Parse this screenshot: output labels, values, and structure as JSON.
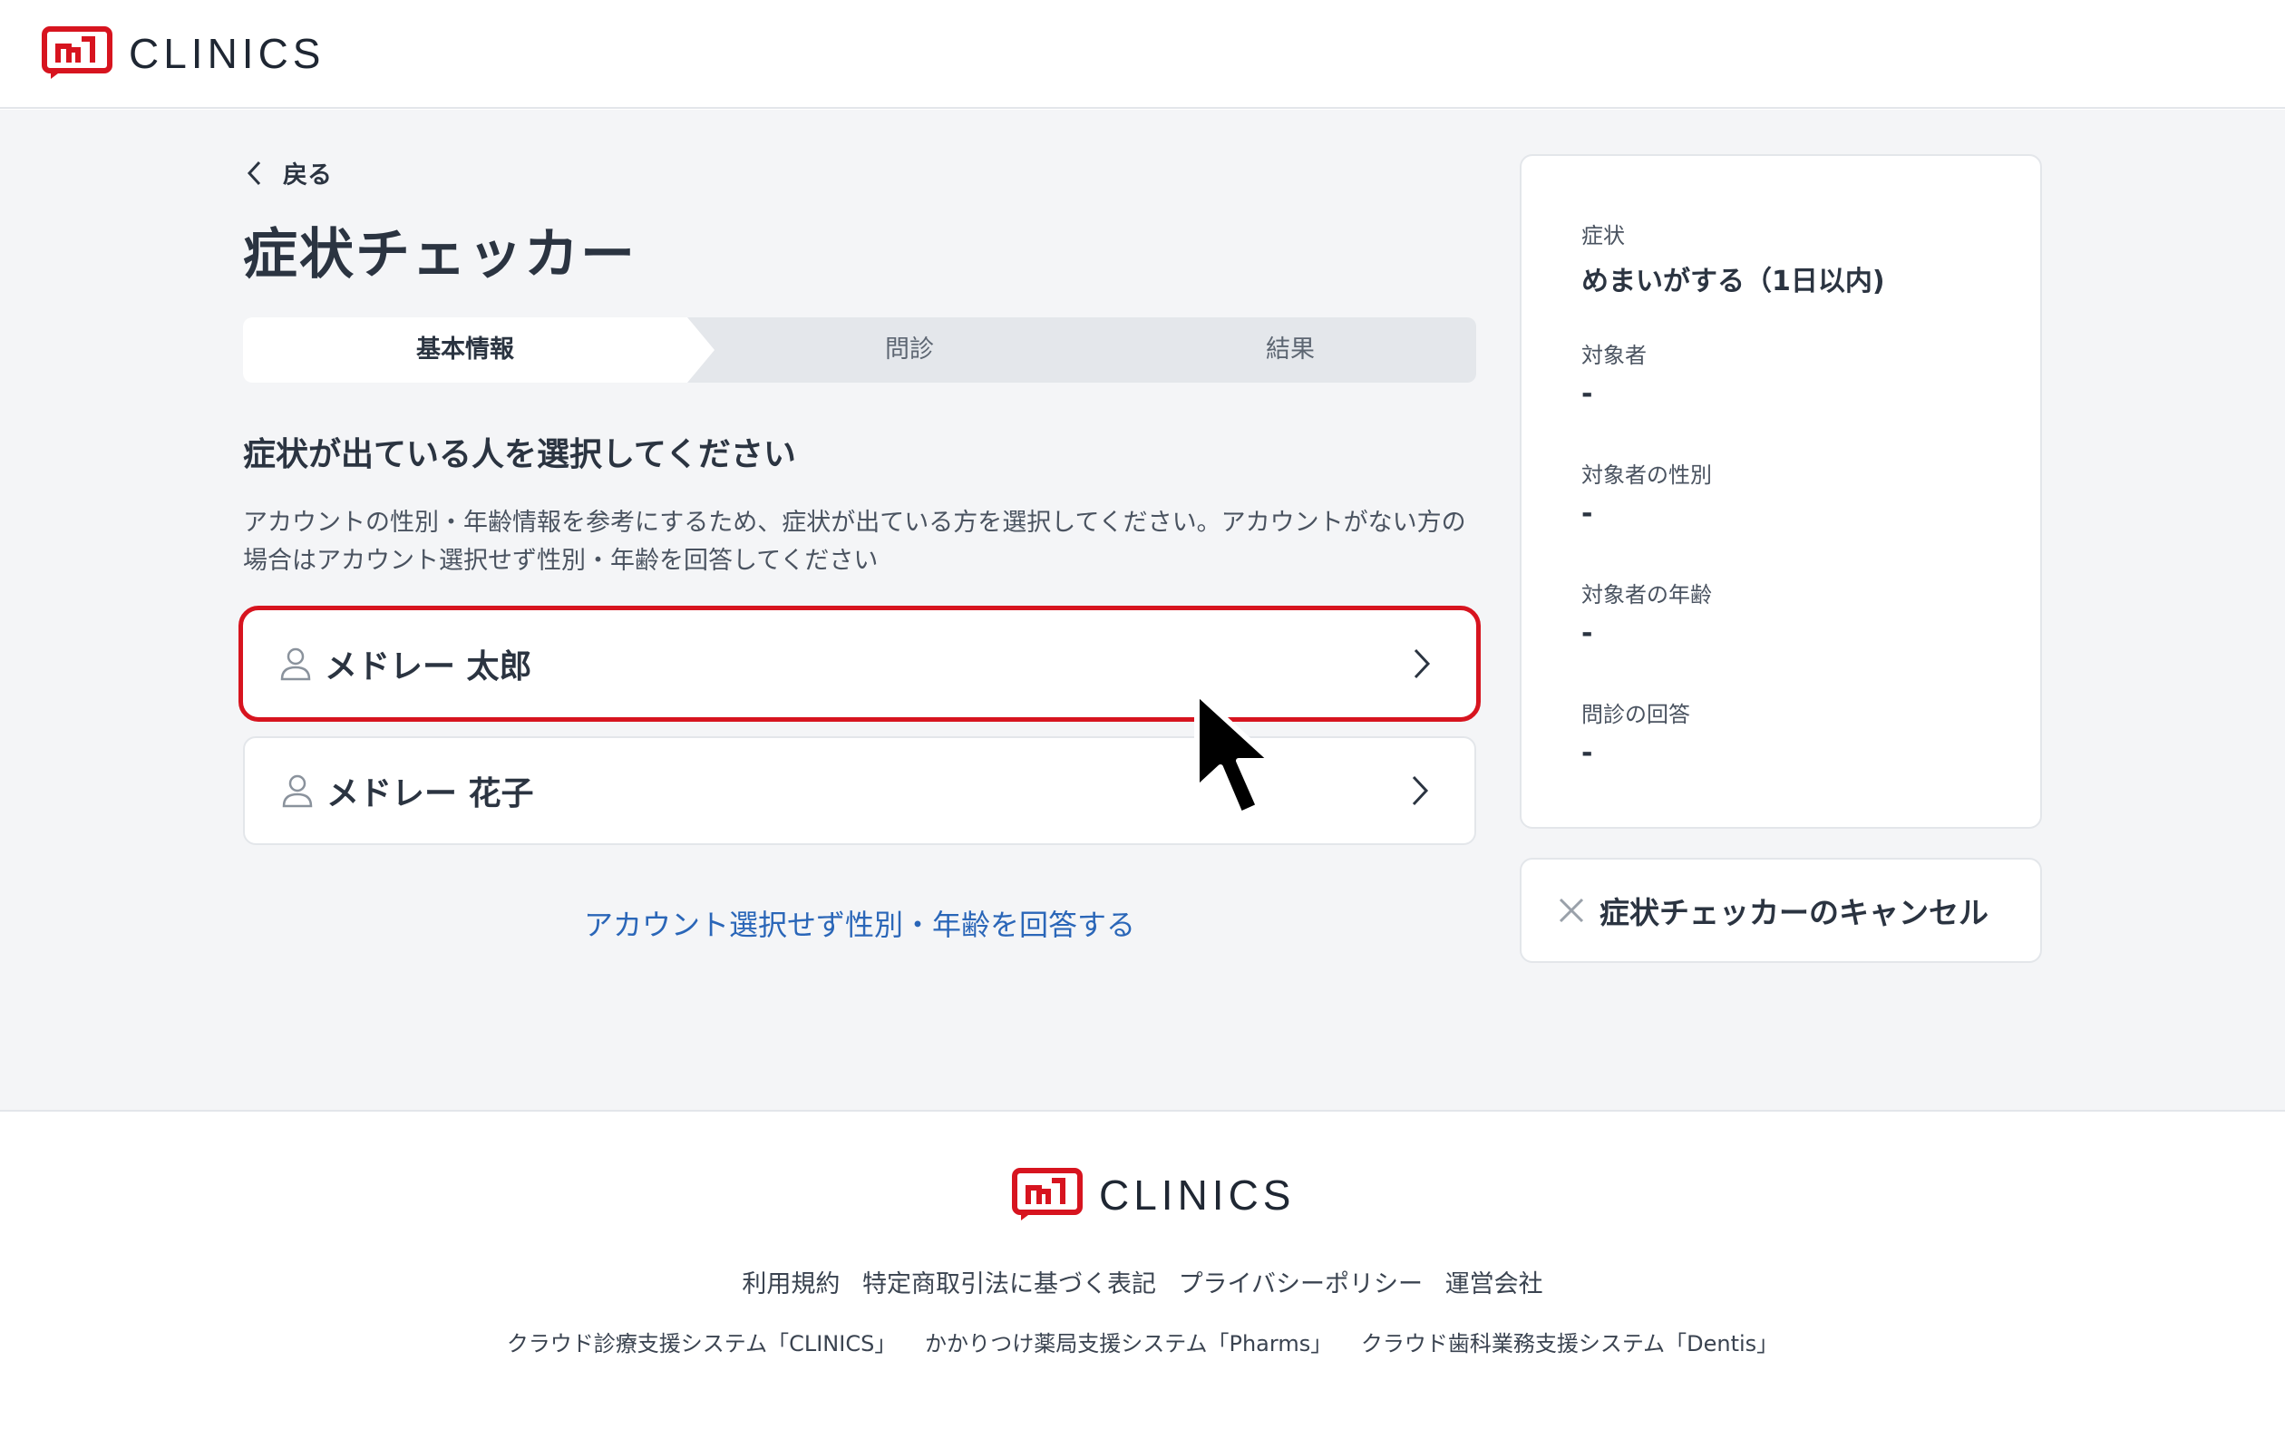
{
  "header": {
    "logo_text": "CLINICS",
    "brand_color": "#d7141f"
  },
  "nav": {
    "back_label": "戻る"
  },
  "page": {
    "title": "症状チェッカー"
  },
  "stepper": {
    "steps": [
      {
        "label": "基本情報",
        "active": true
      },
      {
        "label": "問診",
        "active": false
      },
      {
        "label": "結果",
        "active": false
      }
    ]
  },
  "section": {
    "title": "症状が出ている人を選択してください",
    "description": "アカウントの性別・年齢情報を参考にするため、症状が出ている方を選択してください。アカウントがない方の場合はアカウント選択せず性別・年齢を回答してください"
  },
  "persons": [
    {
      "name": "メドレー 太郎",
      "highlighted": true
    },
    {
      "name": "メドレー 花子",
      "highlighted": false
    }
  ],
  "alt_link": "アカウント選択せず性別・年齢を回答する",
  "summary": {
    "items": [
      {
        "label": "症状",
        "value": "めまいがする（1日以内)"
      },
      {
        "label": "対象者",
        "value": "-"
      },
      {
        "label": "対象者の性別",
        "value": "-"
      },
      {
        "label": "対象者の年齢",
        "value": "-"
      },
      {
        "label": "問診の回答",
        "value": "-"
      }
    ]
  },
  "cancel": {
    "label": "症状チェッカーのキャンセル"
  },
  "footer": {
    "logo_text": "CLINICS",
    "links": [
      "利用規約",
      "特定商取引法に基づく表記",
      "プライバシーポリシー",
      "運営会社"
    ],
    "services": [
      "クラウド診療支援システム「CLINICS」",
      "かかりつけ薬局支援システム「Pharms」",
      "クラウド歯科業務支援システム「Dentis」"
    ]
  },
  "icons": {
    "back": "chevron-left-icon",
    "user": "user-icon",
    "chevron": "chevron-right-icon",
    "close": "close-icon",
    "cursor": "mouse-cursor-icon"
  }
}
